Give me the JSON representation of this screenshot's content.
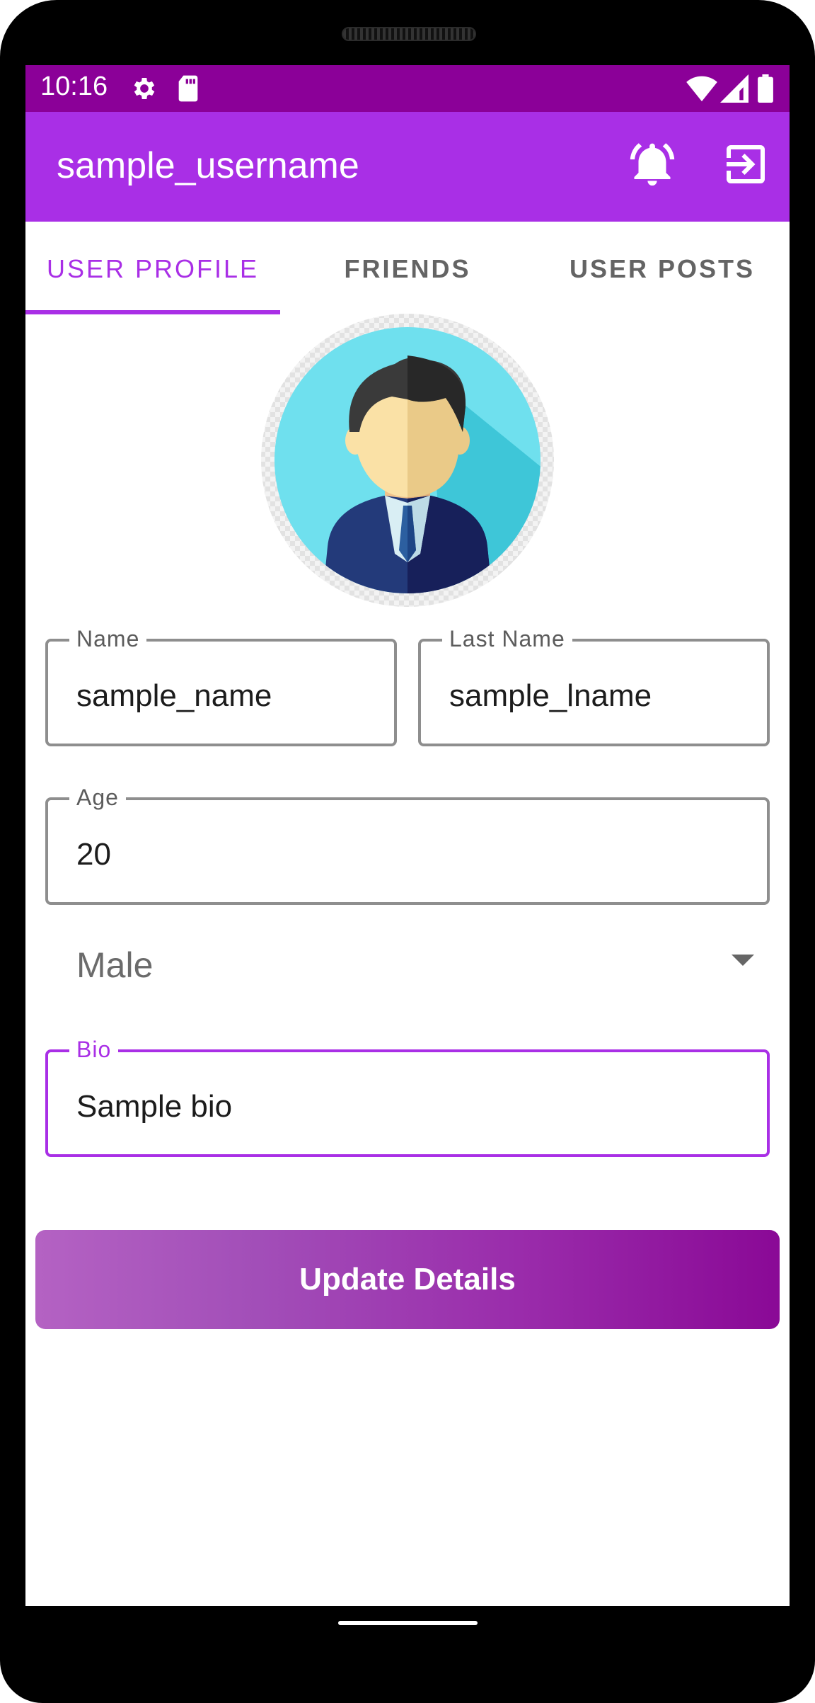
{
  "status_bar": {
    "time": "10:16",
    "icons": [
      "gear-icon",
      "sd-card-icon",
      "wifi-icon",
      "signal-icon",
      "battery-icon"
    ]
  },
  "app_bar": {
    "title": "sample_username",
    "actions": [
      "alarm-bell-icon",
      "logout-icon"
    ]
  },
  "tabs": [
    {
      "label": "USER PROFILE",
      "active": true
    },
    {
      "label": "FRIENDS",
      "active": false
    },
    {
      "label": "USER POSTS",
      "active": false
    }
  ],
  "profile": {
    "avatar": "user-avatar-icon",
    "fields": {
      "name": {
        "label": "Name",
        "value": "sample_name"
      },
      "last_name": {
        "label": "Last Name",
        "value": "sample_lname"
      },
      "age": {
        "label": "Age",
        "value": "20"
      },
      "gender": {
        "value": "Male"
      },
      "bio": {
        "label": "Bio",
        "value": "Sample bio"
      }
    }
  },
  "actions": {
    "update_label": "Update Details"
  },
  "colors": {
    "status_bar": "#8b0098",
    "app_bar": "#a92fe6",
    "accent": "#a92fe6",
    "button_gradient_start": "#b462c3",
    "button_gradient_end": "#8a0996"
  }
}
